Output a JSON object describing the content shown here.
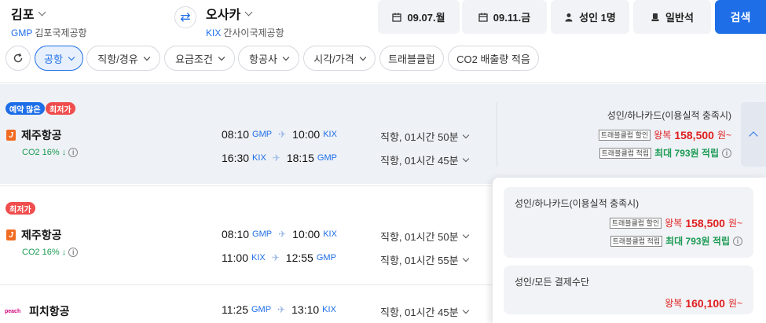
{
  "header": {
    "origin": {
      "name": "김포",
      "code": "GMP",
      "airport": "김포국제공항"
    },
    "destination": {
      "name": "오사카",
      "code": "KIX",
      "airport": "간사이국제공항"
    },
    "depart_date": "09.07.월",
    "return_date": "09.11.금",
    "passengers": "성인 1명",
    "cabin": "일반석",
    "search_label": "검색"
  },
  "filters": [
    {
      "label": "공항",
      "active": true,
      "chevron": true
    },
    {
      "label": "직항/경유",
      "active": false,
      "chevron": true
    },
    {
      "label": "요금조건",
      "active": false,
      "chevron": true
    },
    {
      "label": "항공사",
      "active": false,
      "chevron": true
    },
    {
      "label": "시각/가격",
      "active": false,
      "chevron": true
    },
    {
      "label": "트래블클럽",
      "active": false,
      "chevron": false
    },
    {
      "label": "CO2 배출량 적음",
      "active": false,
      "chevron": false
    }
  ],
  "results": [
    {
      "badges": [
        "예약 많은",
        "최저가"
      ],
      "airline": "제주항공",
      "co2": "CO2 16%",
      "co2_arrow": "↓",
      "legs": [
        {
          "dep_time": "08:10",
          "dep_ap": "GMP",
          "arr_time": "10:00",
          "arr_ap": "KIX",
          "duration": "직항, 01시간 50분"
        },
        {
          "dep_time": "16:30",
          "dep_ap": "KIX",
          "arr_time": "18:15",
          "arr_ap": "GMP",
          "duration": "직항, 01시간 45분"
        }
      ],
      "price": {
        "condition": "성인/하나카드(이용실적 충족시)",
        "discount_tag": "트래블클럽 할인",
        "round_label": "왕복",
        "amount": "158,500",
        "currency_suffix": "원~",
        "points_tag": "트래블클럽 적립",
        "points_text": "최대 793원 적립"
      }
    },
    {
      "badges": [
        "최저가"
      ],
      "airline": "제주항공",
      "co2": "CO2 16%",
      "co2_arrow": "↓",
      "legs": [
        {
          "dep_time": "08:10",
          "dep_ap": "GMP",
          "arr_time": "10:00",
          "arr_ap": "KIX",
          "duration": "직항, 01시간 50분"
        },
        {
          "dep_time": "11:00",
          "dep_ap": "KIX",
          "arr_time": "12:55",
          "arr_ap": "GMP",
          "duration": "직항, 01시간 55분"
        }
      ]
    },
    {
      "badges": [],
      "airline": "피치항공",
      "logo_text": "peach",
      "legs": [
        {
          "dep_time": "11:25",
          "dep_ap": "GMP",
          "arr_time": "13:10",
          "arr_ap": "KIX",
          "duration": "직항, 01시간 45분"
        }
      ]
    }
  ],
  "price_panel": [
    {
      "condition": "성인/하나카드(이용실적 충족시)",
      "discount_tag": "트래블클럽 할인",
      "round_label": "왕복",
      "amount": "158,500",
      "currency_suffix": "원~",
      "points_tag": "트래블클럽 적립",
      "points_text": "최대 793원 적립"
    },
    {
      "condition": "성인/모든 결제수단",
      "round_label": "왕복",
      "amount": "160,100",
      "currency_suffix": "원~"
    }
  ],
  "colors": {
    "accent": "#1e6ee8",
    "price_red": "#e02020",
    "eco_green": "#1a9a52"
  }
}
